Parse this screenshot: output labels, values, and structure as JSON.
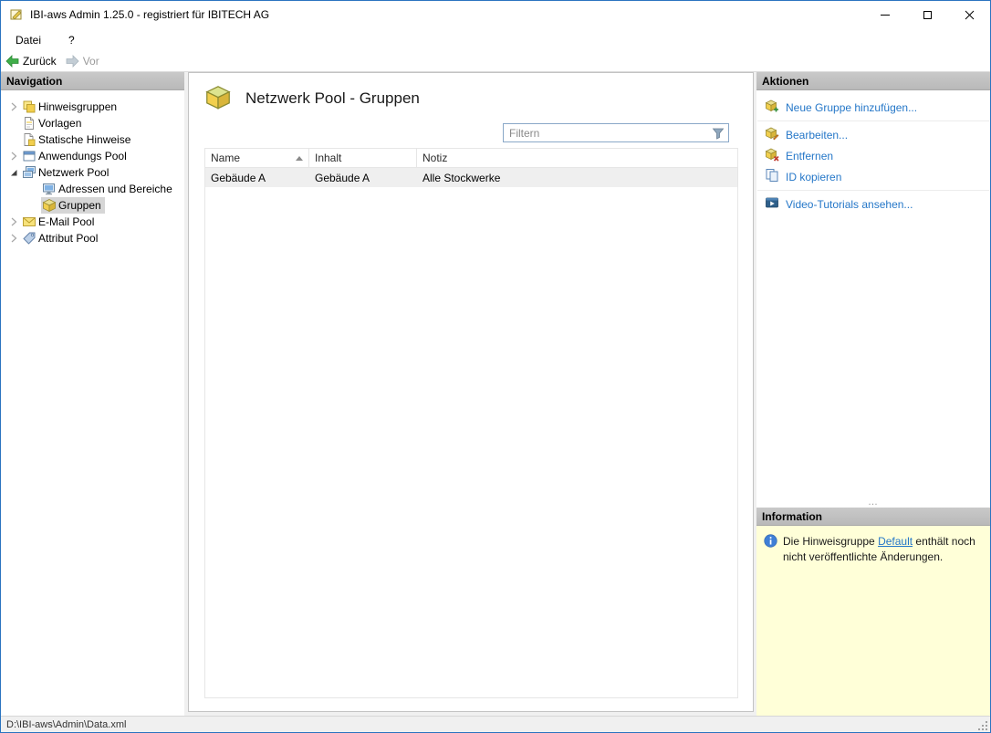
{
  "window": {
    "title": "IBI-aws Admin 1.25.0 - registriert für IBITECH AG"
  },
  "menubar": {
    "items": [
      {
        "label": "Datei"
      },
      {
        "label": "?"
      }
    ]
  },
  "toolbar": {
    "back_label": "Zurück",
    "forward_label": "Vor"
  },
  "navigation": {
    "header": "Navigation",
    "items": [
      {
        "label": "Hinweisgruppen"
      },
      {
        "label": "Vorlagen"
      },
      {
        "label": "Statische Hinweise"
      },
      {
        "label": "Anwendungs Pool"
      },
      {
        "label": "Netzwerk Pool"
      },
      {
        "label": "Adressen und Bereiche"
      },
      {
        "label": "Gruppen"
      },
      {
        "label": "E-Mail Pool"
      },
      {
        "label": "Attribut Pool"
      }
    ]
  },
  "content": {
    "title": "Netzwerk Pool - Gruppen",
    "filter": {
      "placeholder": "Filtern"
    },
    "table": {
      "columns": [
        {
          "label": "Name"
        },
        {
          "label": "Inhalt"
        },
        {
          "label": "Notiz"
        }
      ],
      "rows": [
        {
          "name": "Gebäude A",
          "inhalt": "Gebäude A",
          "notiz": "Alle Stockwerke"
        }
      ]
    }
  },
  "actions": {
    "header": "Aktionen",
    "items": [
      {
        "label": "Neue Gruppe hinzufügen..."
      },
      {
        "label": "Bearbeiten..."
      },
      {
        "label": "Entfernen"
      },
      {
        "label": "ID kopieren"
      },
      {
        "label": "Video-Tutorials ansehen..."
      }
    ],
    "overflow": "…"
  },
  "information": {
    "header": "Information",
    "text_before": "Die Hinweisgruppe ",
    "link_label": "Default",
    "text_after": " enthält noch nicht veröffentlichte Änderungen."
  },
  "statusbar": {
    "path": "D:\\IBI-aws\\Admin\\Data.xml"
  }
}
